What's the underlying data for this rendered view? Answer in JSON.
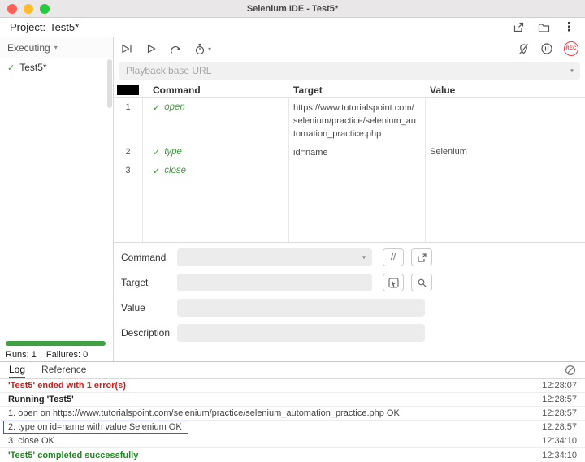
{
  "window": {
    "title": "Selenium IDE - Test5*"
  },
  "project": {
    "label": "Project:",
    "name": "Test5*"
  },
  "sidebar": {
    "dropdown_label": "Executing",
    "tests": [
      {
        "name": "Test5*"
      }
    ],
    "runs": "Runs: 1",
    "failures": "Failures: 0"
  },
  "toolbar": {
    "rec_label": "REC"
  },
  "playback": {
    "placeholder": "Playback base URL"
  },
  "table": {
    "columns": [
      "Command",
      "Target",
      "Value"
    ],
    "rows": [
      {
        "num": "1",
        "command": "open",
        "target": "https://www.tutorialspoint.com/selenium/practice/selenium_automation_practice.php",
        "value": ""
      },
      {
        "num": "2",
        "command": "type",
        "target": "id=name",
        "value": "Selenium"
      },
      {
        "num": "3",
        "command": "close",
        "target": "",
        "value": ""
      }
    ]
  },
  "form": {
    "command_label": "Command",
    "target_label": "Target",
    "value_label": "Value",
    "description_label": "Description",
    "double_slash_label": "//"
  },
  "log_panel": {
    "tabs": [
      {
        "label": "Log"
      },
      {
        "label": "Reference"
      }
    ],
    "entries": [
      {
        "text": "'Test5' ended with 1 error(s)",
        "time": "12:28:07"
      },
      {
        "text": "Running 'Test5'",
        "time": "12:28:57"
      },
      {
        "text": "1.  open on https://www.tutorialspoint.com/selenium/practice/selenium_automation_practice.php OK",
        "time": "12:28:57"
      },
      {
        "text": "2.  type on id=name with value Selenium OK",
        "time": "12:28:57"
      },
      {
        "text": "3.  close OK",
        "time": "12:34:10"
      },
      {
        "text": "'Test5' completed successfully",
        "time": "12:34:10"
      }
    ]
  },
  "icons": {
    "check": "✓",
    "menu": "⋮",
    "caret": "▾"
  }
}
